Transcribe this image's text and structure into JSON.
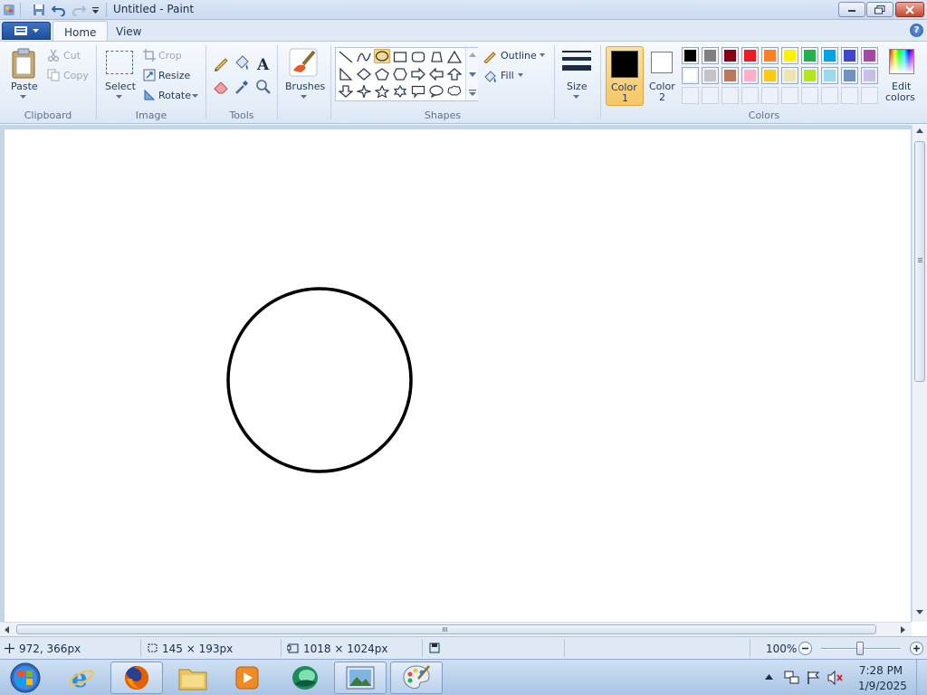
{
  "titlebar": {
    "title": "Untitled - Paint"
  },
  "tabs": [
    {
      "label": "Home"
    },
    {
      "label": "View"
    }
  ],
  "ribbon": {
    "clipboard": {
      "paste": "Paste",
      "cut": "Cut",
      "copy": "Copy",
      "group": "Clipboard"
    },
    "image": {
      "select": "Select",
      "crop": "Crop",
      "resize": "Resize",
      "rotate": "Rotate",
      "group": "Image"
    },
    "tools": {
      "group": "Tools"
    },
    "brushes": {
      "label": "Brushes"
    },
    "shapes": {
      "outline": "Outline",
      "fill": "Fill",
      "group": "Shapes"
    },
    "size": {
      "label": "Size"
    },
    "color1": {
      "line1": "Color",
      "line2": "1"
    },
    "color2": {
      "line1": "Color",
      "line2": "2"
    },
    "editcolors": {
      "line1": "Edit",
      "line2": "colors"
    },
    "colors": {
      "group": "Colors",
      "row1": [
        "#000000",
        "#7f7f7f",
        "#880015",
        "#ed1c24",
        "#ff7f27",
        "#fff200",
        "#22b14c",
        "#00a2e8",
        "#3f48cc",
        "#a349a4"
      ],
      "row2": [
        "#ffffff",
        "#c3c3c3",
        "#b97a57",
        "#ffaec9",
        "#ffc90e",
        "#efe4b0",
        "#b5e61d",
        "#99d9ea",
        "#7092be",
        "#c8bfe7"
      ]
    },
    "active_color1": "#000000",
    "active_color2": "#ffffff"
  },
  "canvas": {
    "shape": "circle",
    "stroke": "#000000"
  },
  "statusbar": {
    "cursor": "972, 366px",
    "selection": "145 × 193px",
    "canvas_size": "1018 × 1024px",
    "zoom": "100%"
  },
  "taskbar": {
    "items": [
      "start-orb",
      "internet-explorer",
      "firefox",
      "file-explorer",
      "media-player",
      "app-green",
      "image-viewer",
      "paint"
    ],
    "time": "7:28 PM",
    "date": "1/9/2025"
  }
}
